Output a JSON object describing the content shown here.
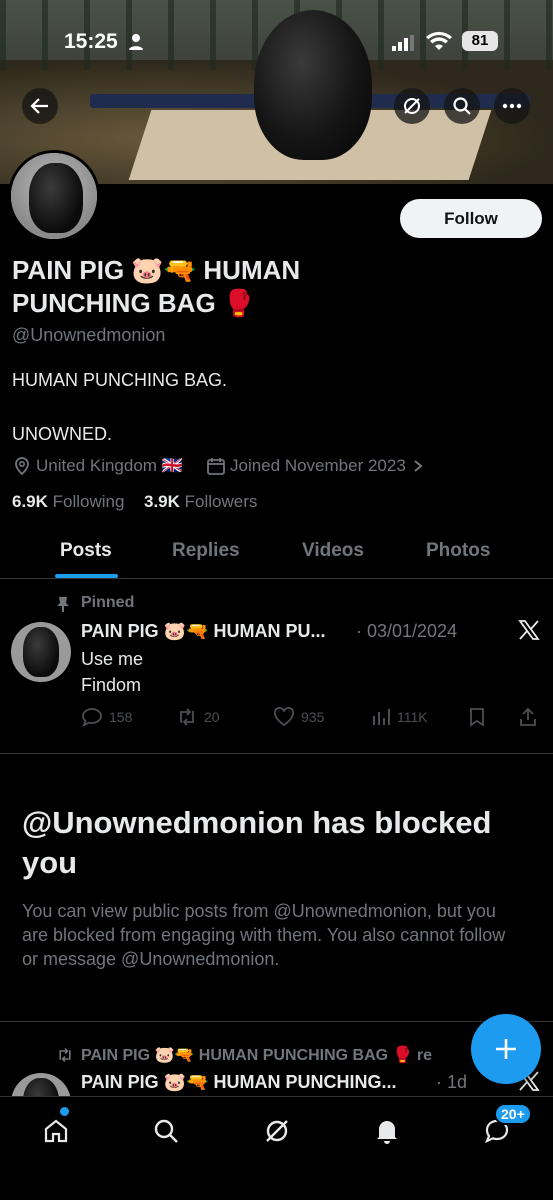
{
  "status_bar": {
    "time": "15:25",
    "battery": "81"
  },
  "profile": {
    "display_name": "PAIN PIG 🐷🔫 HUMAN PUNCHING BAG 🥊",
    "handle": "@Unownedmonion",
    "follow_label": "Follow",
    "bio_line1": "HUMAN PUNCHING BAG.",
    "bio_line2": "UNOWNED.",
    "location": "United Kingdom 🇬🇧",
    "joined": "Joined November 2023",
    "following_count": "6.9K",
    "following_label": "Following",
    "followers_count": "3.9K",
    "followers_label": "Followers"
  },
  "tabs": [
    {
      "label": "Posts"
    },
    {
      "label": "Replies"
    },
    {
      "label": "Videos"
    },
    {
      "label": "Photos"
    }
  ],
  "pinned_post": {
    "pinned_label": "Pinned",
    "author": "PAIN PIG 🐷🔫 HUMAN PU...",
    "date": "· 03/01/2024",
    "line1": "Use me",
    "line2": "Findom",
    "replies": "158",
    "reposts": "20",
    "likes": "935",
    "views": "111K"
  },
  "blocked": {
    "title": "@Unownedmonion has blocked you",
    "body": "You can view public posts from @Unownedmonion, but you are blocked from engaging with them. You also cannot follow or message @Unownedmonion."
  },
  "next_post": {
    "repost_label": "PAIN PIG 🐷🔫 HUMAN PUNCHING BAG 🥊 re",
    "author": "PAIN PIG 🐷🔫 HUMAN PUNCHING...",
    "date": "· 1d"
  },
  "bottom_nav": {
    "messages_badge": "20+"
  },
  "colors": {
    "accent": "#1d9bf0",
    "background": "#000000",
    "muted": "#71767b"
  }
}
